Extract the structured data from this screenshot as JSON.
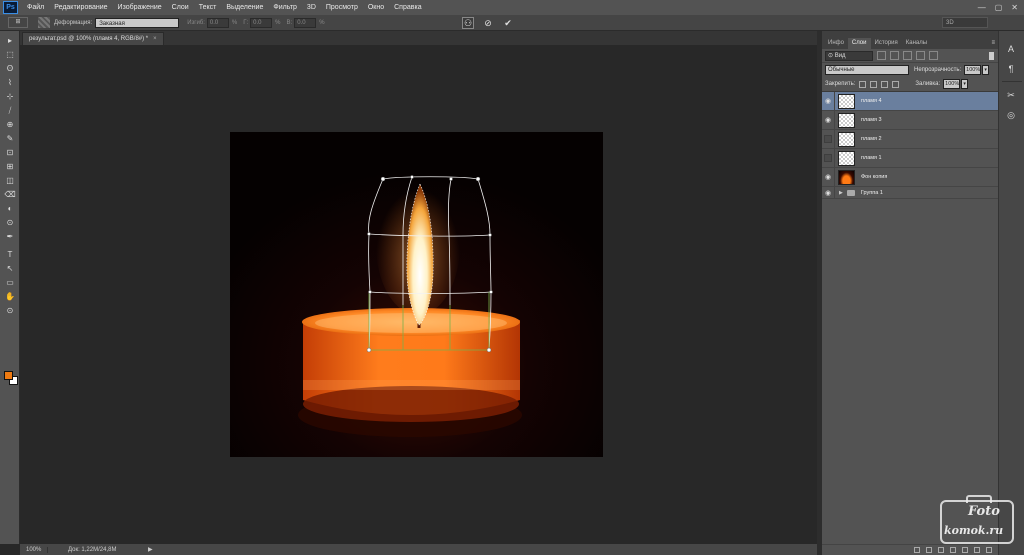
{
  "app": {
    "logo": "Ps"
  },
  "menu": [
    "Файл",
    "Редактирование",
    "Изображение",
    "Слои",
    "Текст",
    "Выделение",
    "Фильтр",
    "3D",
    "Просмотр",
    "Окно",
    "Справка"
  ],
  "window_controls": [
    "—",
    "▢",
    "✕"
  ],
  "options_bar": {
    "tool_label": "⊞",
    "deform_label": "Деформация:",
    "deform_value": "Заказная",
    "bend_label": "Изгиб:",
    "bend_value": "0.0",
    "h_label": "Г:",
    "h_value": "0.0",
    "v_label": "В:",
    "v_value": "0.0",
    "pct": "%",
    "workspace": "3D"
  },
  "document": {
    "tab_title": "результат.psd @ 100% (пламя 4, RGB/8#) *",
    "tab_close": "×",
    "zoom": "100%",
    "doc_info": "Док: 1,22M/24,8M",
    "status_arrow": "▶"
  },
  "tools": [
    "▸",
    "⬚",
    "ʘ",
    "⌇",
    "⊹",
    "⧸",
    "⊕",
    "✎",
    "⊡",
    "⊞",
    "◫",
    "⌫",
    "◐",
    "⊙",
    "✒",
    "T",
    "↖",
    "▭",
    "✋",
    "⊙"
  ],
  "foreground_color": "#ee7a11",
  "background_color": "#ffffff",
  "panel": {
    "tabs": [
      "Инфо",
      "Слои",
      "История",
      "Каналы"
    ],
    "active_tab": "Слои",
    "menu_icon": "≡",
    "filter_label": "⊙ Вид",
    "blend_mode": "Обычные",
    "opacity_label": "Непрозрачность:",
    "opacity_value": "100%",
    "lock_label": "Закрепить:",
    "fill_label": "Заливка:",
    "fill_value": "100%",
    "layers": [
      {
        "name": "пламя 4",
        "visible": true,
        "selected": true,
        "thumb": "transparent"
      },
      {
        "name": "пламя 3",
        "visible": true,
        "selected": false,
        "thumb": "transparent"
      },
      {
        "name": "пламя 2",
        "visible": false,
        "selected": false,
        "thumb": "transparent"
      },
      {
        "name": "пламя 1",
        "visible": false,
        "selected": false,
        "thumb": "transparent"
      },
      {
        "name": "Фон копия",
        "visible": true,
        "selected": false,
        "thumb": "candle"
      }
    ],
    "group": {
      "name": "Группа 1",
      "visible": true
    }
  },
  "watermark": {
    "line1": "Foto",
    "line2": "komok.ru"
  },
  "colors": {
    "accent_selected_layer": "#6a7f9e",
    "candle_orange": "#ff7a14",
    "warp_grid": "#ffffff",
    "warp_grid_bottom": "#7ab04a"
  }
}
